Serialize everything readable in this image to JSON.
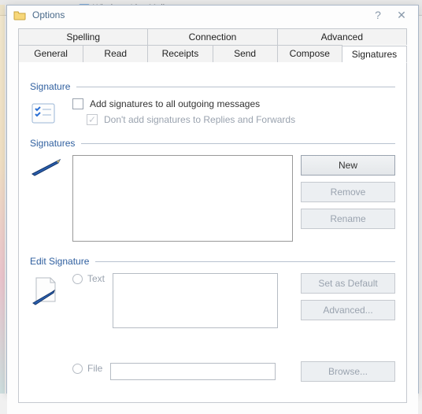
{
  "bg_app": "Windows Live Mail",
  "window": {
    "title": "Options",
    "help_glyph": "?",
    "close_glyph": "✕"
  },
  "tabs": {
    "row1": [
      "Spelling",
      "Connection",
      "Advanced"
    ],
    "row2": [
      "General",
      "Read",
      "Receipts",
      "Send",
      "Compose",
      "Signatures"
    ],
    "active": "Signatures"
  },
  "section_signature": {
    "title": "Signature",
    "chk1": "Add signatures to all outgoing messages",
    "chk2": "Don't add signatures to Replies and Forwards"
  },
  "section_signatures": {
    "title": "Signatures",
    "buttons": {
      "new": "New",
      "remove": "Remove",
      "rename": "Rename"
    }
  },
  "section_edit": {
    "title": "Edit Signature",
    "opt_text": "Text",
    "opt_file": "File",
    "buttons": {
      "default": "Set as Default",
      "advanced": "Advanced...",
      "browse": "Browse..."
    }
  }
}
